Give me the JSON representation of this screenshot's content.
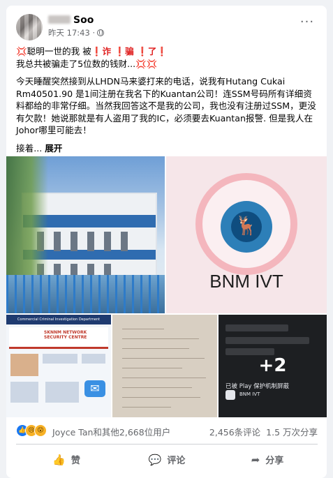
{
  "post": {
    "author": "Soo",
    "time": "昨天 17:43 ·",
    "more": "···",
    "text": {
      "line1_a": "💢聪明一世的我 被",
      "line1_b": "❗诈 ❗骗 ❗了❗",
      "line2": "我总共被骗走了5位数的钱财...💢💢",
      "para": "今天睡醒突然接到从LHDN马来婆打来的电话，说我有Hutang Cukai Rm40501.90 是1间注册在我名下的Kuantan公司！连SSM号码所有详细资料都给的非常仔细。当然我回答这不是我的公司，我也没有注册过SSM，更没有欠款！她说那就是有人盗用了我的IC，必须要去Kuantan报警. 但是我人在Johor哪里可能去！",
      "ellipsis": "接着... ",
      "see_more": "展开"
    }
  },
  "media": {
    "tile2_text": "BNM IVT",
    "tile3_header": "Commercial Criminal Investigation Department",
    "tile3_title": "SKNNM NETWORK SECURITY CENTRE",
    "more_count": "+2",
    "tile5_label": "已被 Play 保护机制屏蔽",
    "tile5_app": "BNM IVT"
  },
  "reactions": {
    "icons": [
      "like-icon",
      "sad-icon",
      "wow-icon"
    ],
    "names": "Joyce Tan和其他2,668位用户",
    "comments": "2,456条评论",
    "shares": "1.5 万次分享"
  },
  "actions": {
    "like": "赞",
    "comment": "评论",
    "share": "分享"
  }
}
